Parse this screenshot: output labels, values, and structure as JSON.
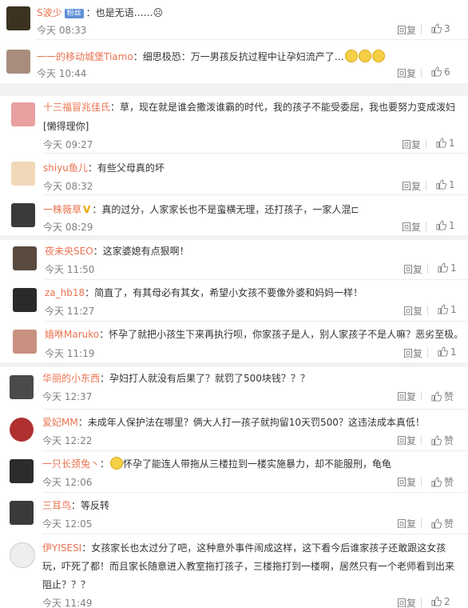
{
  "ui": {
    "reply_label": "回复"
  },
  "blocks": [
    {
      "comments": [
        {
          "user": "S波少",
          "badge": "粉丝",
          "text": "也是无语……☹",
          "time": "今天 08:33",
          "likes": "3",
          "avatar_color": "#3b3320"
        },
        {
          "user": "一一的移动城堡Tiamo",
          "text": "细思极恐：万一男孩反抗过程中让孕妇流产了…",
          "emoji": 3,
          "time": "今天 10:44",
          "likes": "6",
          "avatar_color": "#a88d7e"
        }
      ]
    },
    {
      "comments": [
        {
          "user": "十三福冒兆佳氏",
          "text": "草，现在就是谁会撒泼谁霸的时代，我的孩子不能受委屈，我也要努力变成泼妇",
          "text2": "[懒得理你]",
          "time": "今天 09:27",
          "likes": "1",
          "avatar_color": "#e8a0a0"
        },
        {
          "user": "shiyu鱼儿",
          "text": "有些父母真的坏",
          "time": "今天 08:32",
          "likes": "1",
          "avatar_color": "#f0d8b8"
        },
        {
          "user": "一株薇草",
          "vbadge": "V",
          "text": "真的过分，人家家长也不是蛮横无理，还打孩子，一家人混⊏",
          "time": "今天 08:29",
          "likes": "1",
          "avatar_color": "#3a3a3a"
        }
      ]
    },
    {
      "comments": [
        {
          "user": "夜未央SEO",
          "text": "这家婆媳有点狠啊！",
          "time": "今天 11:50",
          "likes": "1",
          "avatar_color": "#5a4a40"
        },
        {
          "user": "za_hb18",
          "text": "简直了，有其母必有其女，希望小女孩不要像外婆和妈妈一样！",
          "time": "今天 11:27",
          "likes": "1",
          "avatar_color": "#2a2a2a"
        },
        {
          "user": "嫱咻Maruko",
          "text": "怀孕了就把小孩生下来再执行呗，你家孩子是人，别人家孩子不是人嘛？恶劣至极。",
          "time": "今天 11:19",
          "likes": "1",
          "avatar_color": "#c89080"
        }
      ]
    },
    {
      "comments": [
        {
          "user": "华丽的小东西",
          "text": "孕妇打人就没有后果了？就罚了500块钱？？？",
          "time": "今天 12:37",
          "likes": "赞",
          "avatar_color": "#4a4a4a"
        },
        {
          "user": "爱妃MM",
          "text": "未成年人保护法在哪里？俩大人打一孩子就拘留10天罚500？这违法成本真低！",
          "time": "今天 12:22",
          "likes": "赞",
          "avatar_color": "#b03030"
        },
        {
          "user": "一只长颈兔丶",
          "emoji_before": 1,
          "text": "怀孕了能连人带拖从三楼拉到一楼实施暴力，却不能服刑，龟龟",
          "time": "今天 12:06",
          "likes": "赞",
          "avatar_color": "#2c2c2c"
        },
        {
          "user": "三耳鸟",
          "text": "等反转",
          "time": "今天 12:05",
          "likes": "赞",
          "avatar_color": "#3a3a3a"
        },
        {
          "user": "伊YISESI",
          "text": "女孩家长也太过分了吧，这种意外事件闹成这样，这下看今后谁家孩子还敢跟这女孩",
          "text2": "玩，吓死了都！而且家长随意进入教室拖打孩子，三楼拖打到一楼啊，居然只有一个老师看到出来",
          "text3": "阻止？？？",
          "time": "今天 11:49",
          "likes": "2",
          "avatar_color": "#eeeeee"
        }
      ]
    }
  ]
}
